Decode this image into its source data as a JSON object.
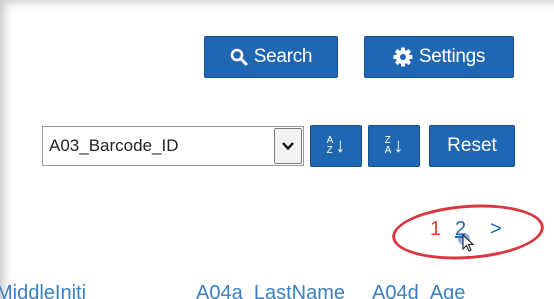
{
  "toolbar": {
    "search_label": "Search",
    "settings_label": "Settings"
  },
  "sort": {
    "field_value": "A03_Barcode_ID",
    "asc_letters_top": "A",
    "asc_letters_bottom": "Z",
    "desc_letters_top": "Z",
    "desc_letters_bottom": "A",
    "reset_label": "Reset"
  },
  "pagination": {
    "current_page": "1",
    "next_page": "2",
    "next_symbol": ">",
    "highlight_color": "#d93640"
  },
  "table": {
    "columns": [
      "MiddleIniti",
      "A04a_LastName",
      "A04d_Age"
    ]
  },
  "colors": {
    "button_bg": "#1f66b3",
    "link": "#3a7fc4",
    "current_page": "#e0452c"
  },
  "icons": [
    "search-icon",
    "gear-icon",
    "chevron-down-icon",
    "sort-ascending-icon",
    "sort-descending-icon",
    "mouse-pointer-icon"
  ]
}
